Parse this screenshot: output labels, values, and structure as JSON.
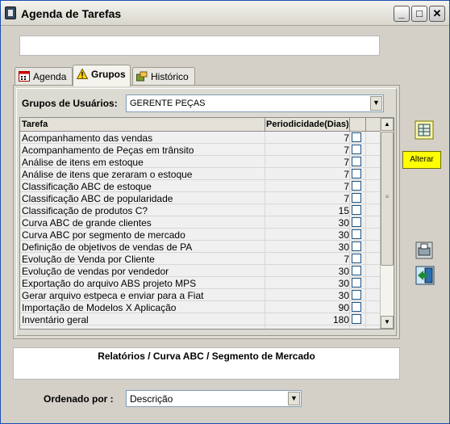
{
  "window": {
    "title": "Agenda de Tarefas"
  },
  "title_buttons": {
    "minimize": "_",
    "maximize": "□",
    "close": "✕"
  },
  "tabs": [
    {
      "label": "Agenda",
      "icon": "calendar-icon"
    },
    {
      "label": "Grupos",
      "icon": "warning-icon",
      "active": true
    },
    {
      "label": "Histórico",
      "icon": "history-icon"
    }
  ],
  "groups": {
    "label": "Grupos de Usuários:",
    "selected": "GERENTE PEÇAS"
  },
  "table": {
    "headers": [
      "Tarefa",
      "Periodicidade(Dias)"
    ],
    "rows": [
      {
        "task": "Acompanhamento das vendas",
        "days": "7"
      },
      {
        "task": "Acompanhamento de Peças em trânsito",
        "days": "7"
      },
      {
        "task": "Análise de itens em estoque",
        "days": "7"
      },
      {
        "task": "Análise de itens que zeraram o estoque",
        "days": "7"
      },
      {
        "task": "Classificação ABC de estoque",
        "days": "7"
      },
      {
        "task": "Classificação ABC de popularidade",
        "days": "7"
      },
      {
        "task": "Classificação de produtos C?",
        "days": "15"
      },
      {
        "task": "Curva ABC de grande clientes",
        "days": "30"
      },
      {
        "task": "Curva ABC por segmento de mercado",
        "days": "30"
      },
      {
        "task": "Definição de objetivos de vendas de PA",
        "days": "30"
      },
      {
        "task": "Evolução de Venda por Cliente",
        "days": "7"
      },
      {
        "task": "Evolução de vendas por vendedor",
        "days": "30"
      },
      {
        "task": "Exportação do arquivo ABS projeto MPS",
        "days": "30"
      },
      {
        "task": "Gerar arquivo estpeca e enviar para a Fiat",
        "days": "30"
      },
      {
        "task": "Importação de Modelos X Aplicação",
        "days": "90"
      },
      {
        "task": "Inventário geral",
        "days": "180"
      }
    ]
  },
  "side": {
    "alterar_label": "Alterar"
  },
  "description": "Relatórios / Curva ABC / Segmento de Mercado",
  "order": {
    "label": "Ordenado por :",
    "selected": "Descrição"
  }
}
